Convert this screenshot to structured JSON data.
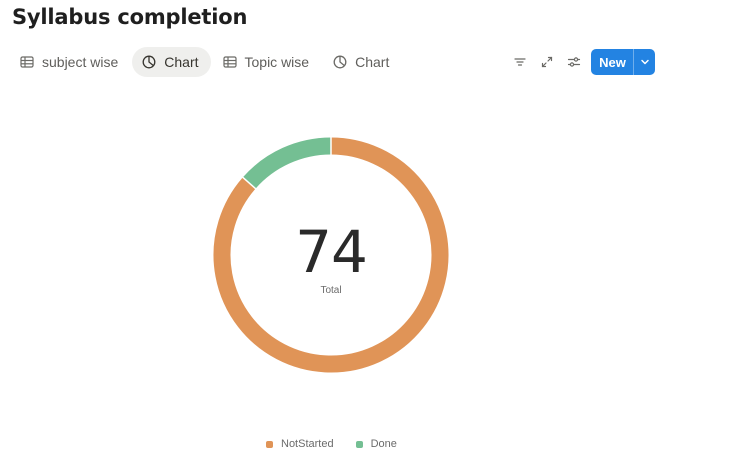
{
  "page": {
    "title": "Syllabus completion"
  },
  "tabs": [
    {
      "label": "subject wise",
      "icon": "table-icon",
      "active": false
    },
    {
      "label": "Chart",
      "icon": "pie-chart-icon",
      "active": true
    },
    {
      "label": "Topic wise",
      "icon": "table-icon",
      "active": false
    },
    {
      "label": "Chart",
      "icon": "pie-chart-icon",
      "active": false
    }
  ],
  "toolbar": {
    "filter_icon": "filter-icon",
    "expand_icon": "expand-icon",
    "settings_icon": "sliders-icon",
    "new_label": "New",
    "accent": "#2383e2"
  },
  "chart_data": {
    "type": "pie",
    "variant": "donut",
    "center_value": "74",
    "center_label": "Total",
    "slices": [
      {
        "name": "NotStarted",
        "value": 64,
        "color": "#e09457"
      },
      {
        "name": "Done",
        "value": 10,
        "color": "#74bf93"
      }
    ],
    "legend_position": "bottom"
  }
}
